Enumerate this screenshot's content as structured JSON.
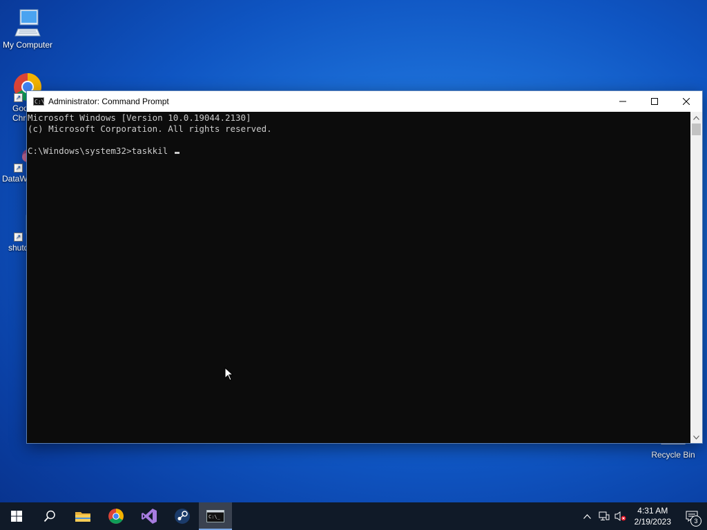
{
  "desktop": {
    "icons": [
      {
        "label": "My Computer"
      },
      {
        "label": "Goo\nChr"
      },
      {
        "label": "DataW"
      },
      {
        "label": "shutd"
      },
      {
        "label": "Recycle Bin"
      }
    ]
  },
  "window": {
    "title": "Administrator:  Command Prompt",
    "console_lines": [
      "Microsoft Windows [Version 10.0.19044.2130]",
      "(c) Microsoft Corporation. All rights reserved.",
      "",
      "C:\\Windows\\system32>taskkil "
    ]
  },
  "taskbar": {
    "apps": [
      {
        "name": "start",
        "icon": "windows-logo-icon"
      },
      {
        "name": "search",
        "icon": "search-icon"
      },
      {
        "name": "file-explorer",
        "icon": "folder-icon"
      },
      {
        "name": "chrome",
        "icon": "chrome-icon"
      },
      {
        "name": "visual-studio",
        "icon": "visual-studio-icon"
      },
      {
        "name": "steam",
        "icon": "steam-icon"
      },
      {
        "name": "command-prompt",
        "icon": "cmd-icon",
        "active": true
      }
    ],
    "clock": {
      "time": "4:31 AM",
      "date": "2/19/2023"
    },
    "notifications_count": "3"
  },
  "colors": {
    "console_bg": "#0c0c0c",
    "console_text": "#cccccc",
    "taskbar_bg": "#101a28",
    "desktop_blue": "#1c6fd8"
  }
}
